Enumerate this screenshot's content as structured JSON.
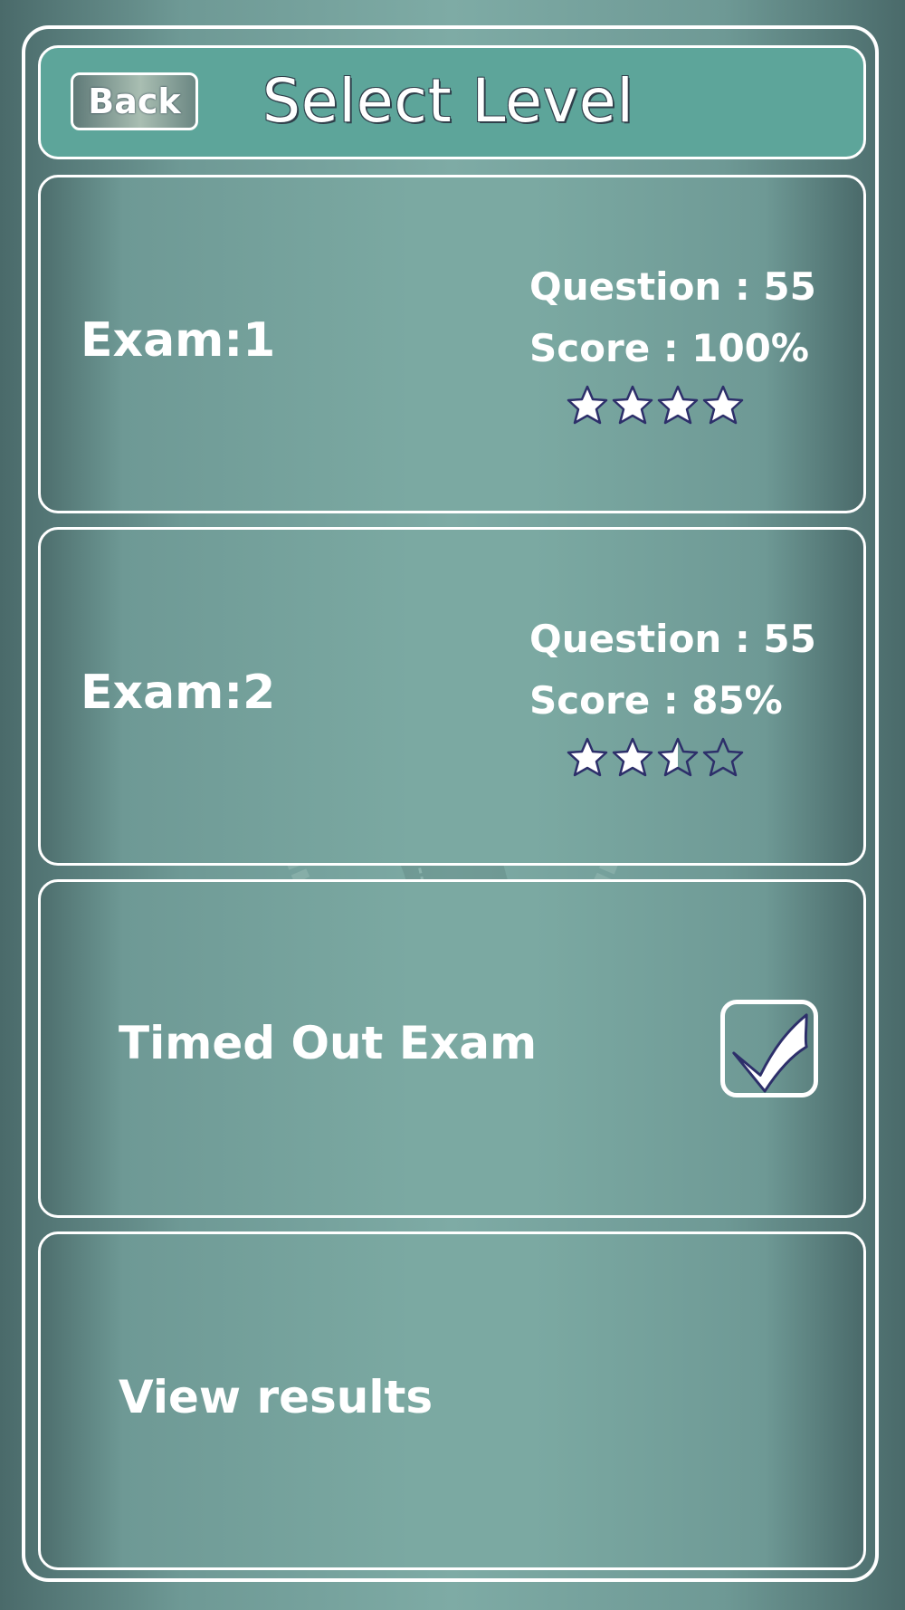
{
  "header": {
    "back_label": "Back",
    "title": "Select Level"
  },
  "exams": [
    {
      "label": "Exam:1",
      "questions": "Question : 55",
      "score": "Score : 100%",
      "stars_rating": 4,
      "stars_max": 4
    },
    {
      "label": "Exam:2",
      "questions": "Question : 55",
      "score": "Score : 85%",
      "stars_rating": 2.5,
      "stars_max": 4
    }
  ],
  "timed": {
    "label": "Timed Out Exam",
    "checked": true
  },
  "results": {
    "label": "View results"
  },
  "colors": {
    "header_bg": "#5da59a",
    "star_fill": "#ffffff",
    "star_outline": "#2d2f6a"
  },
  "icons": {
    "watermark": "brain-head-icon",
    "check": "check-icon",
    "star": "star-icon"
  }
}
